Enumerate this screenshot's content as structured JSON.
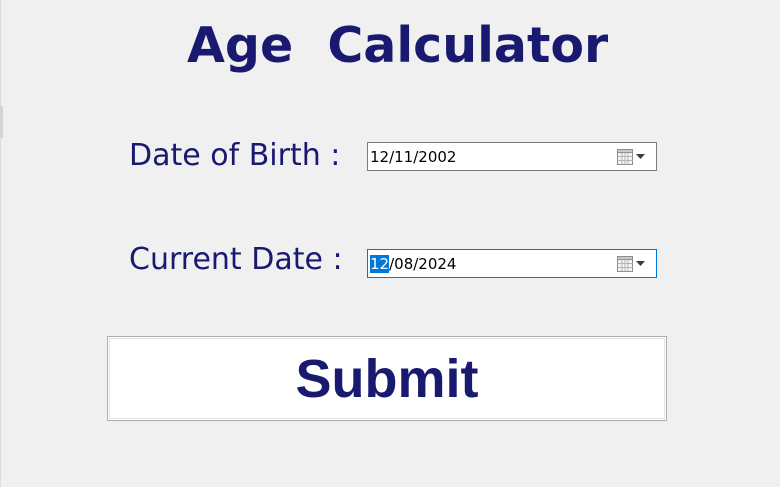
{
  "form": {
    "title": "Age  Calculator",
    "dob": {
      "label": "Date of Birth :",
      "value": "12/11/2002"
    },
    "current": {
      "label": "Current Date :",
      "selected_segment": "12",
      "value_rest": "/08/2024"
    },
    "submit_label": "Submit"
  },
  "colors": {
    "text": "#191970",
    "background": "#f0f0f0",
    "selection": "#0078d7",
    "focus_border": "#0078d7"
  },
  "icons": {
    "date_picker_button": "calendar-icon",
    "date_picker_dropdown": "chevron-down-icon"
  }
}
